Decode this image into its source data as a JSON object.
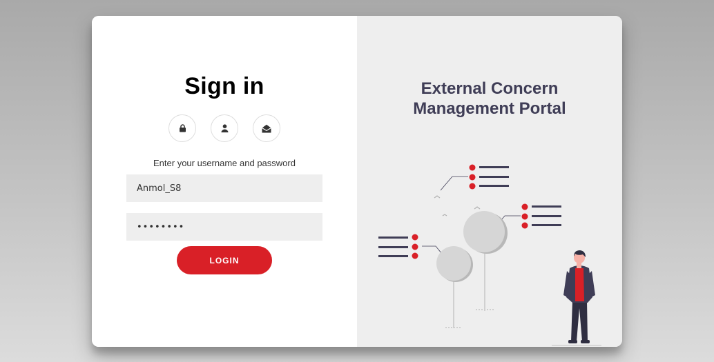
{
  "signin": {
    "title": "Sign in",
    "social_icons": [
      "lock-icon",
      "user-icon",
      "envelope-open-icon"
    ],
    "hint": "Enter your username and password",
    "username_value": "Anmol_S8",
    "password_value": "••••••••",
    "login_label": "LOGIN"
  },
  "portal": {
    "title_line1": "External Concern",
    "title_line2": "Management Portal"
  },
  "colors": {
    "accent": "#d92027",
    "heading_dark": "#3f3d56",
    "panel_gray": "#eeeeee",
    "background": "#b5b5b5"
  }
}
